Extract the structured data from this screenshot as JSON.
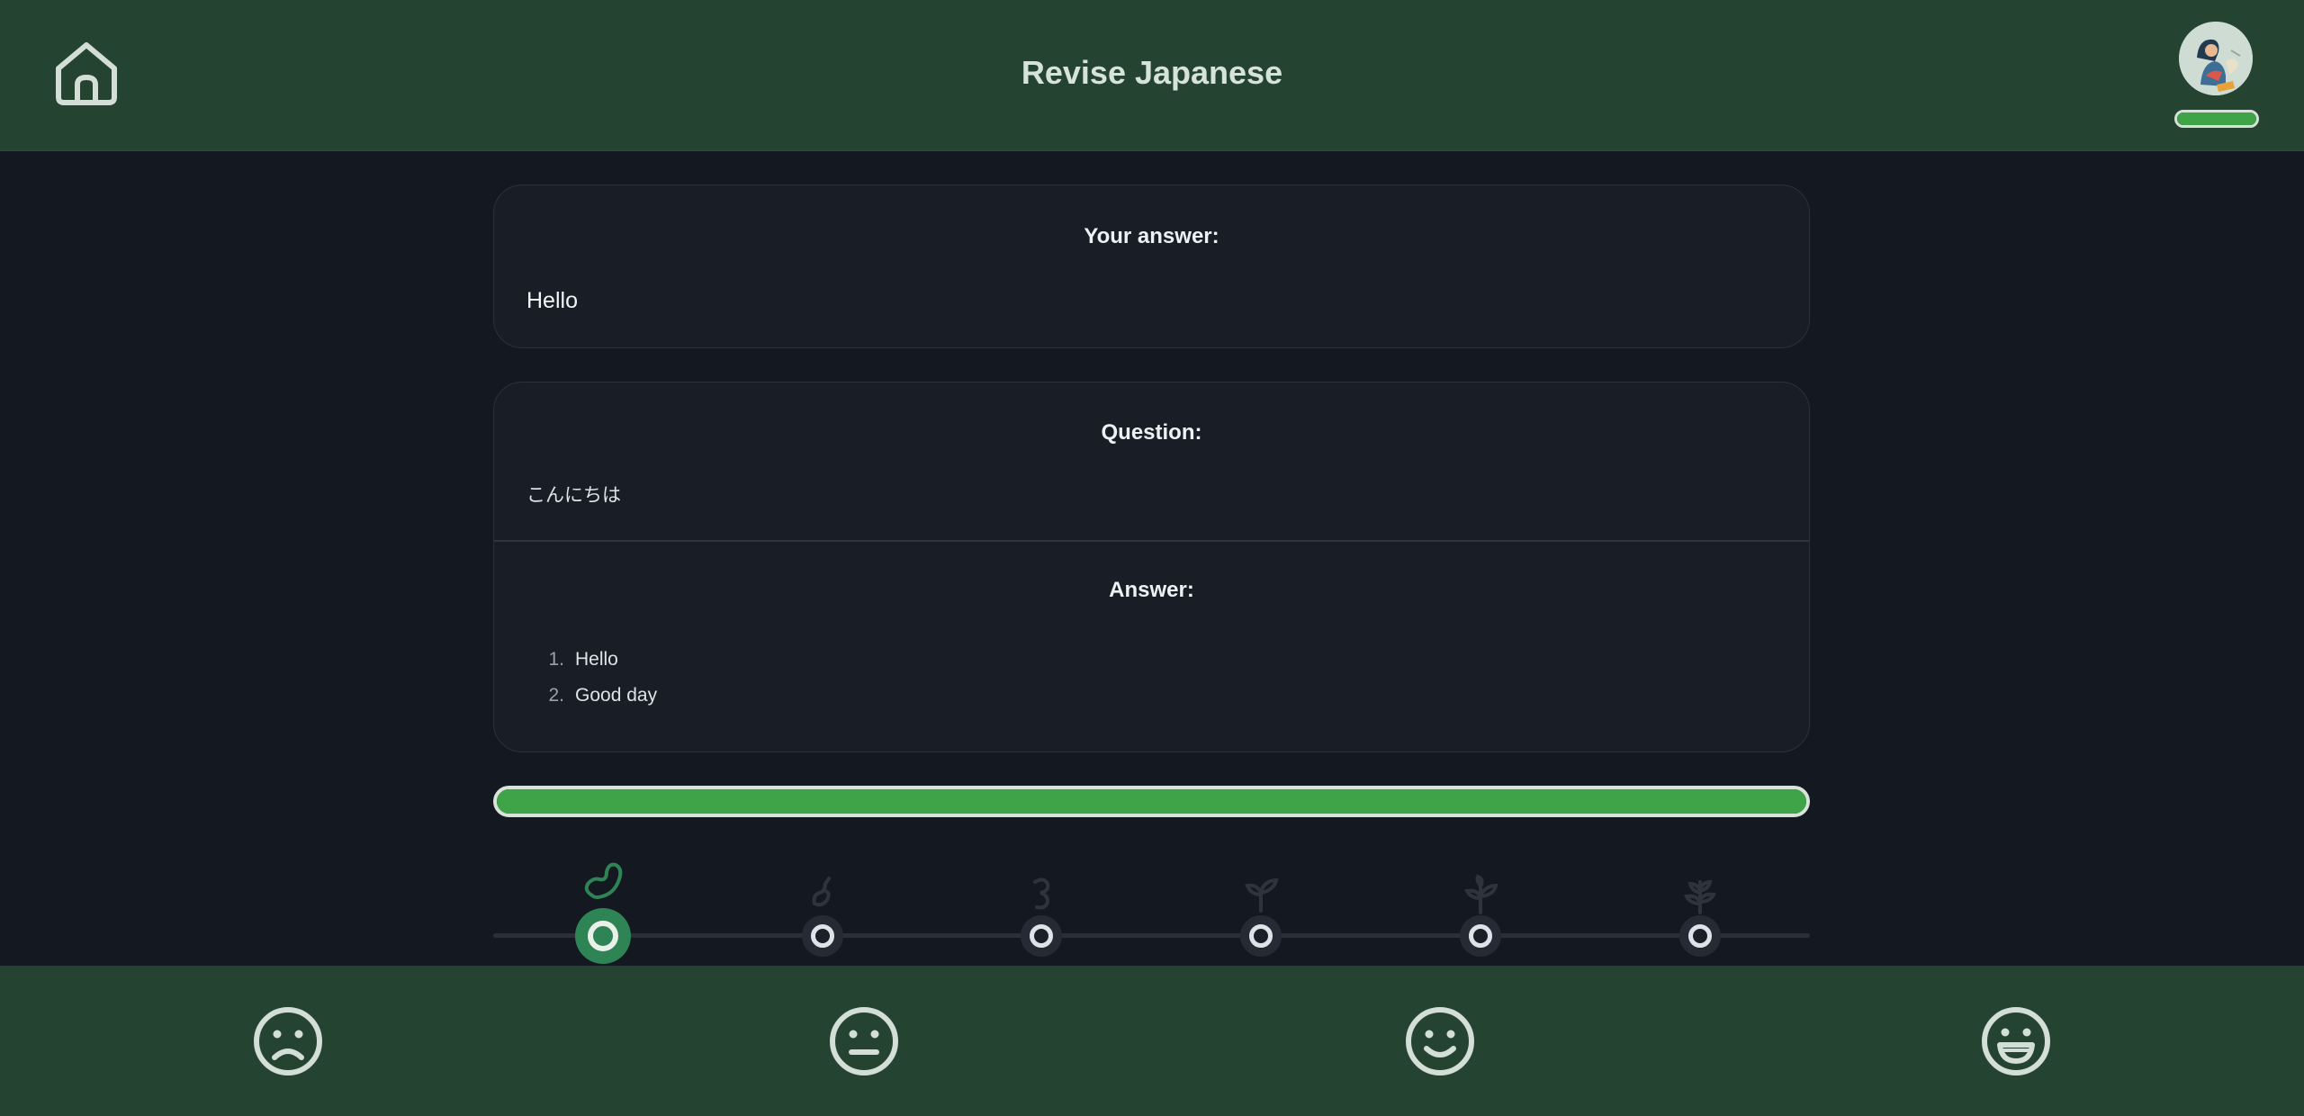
{
  "header": {
    "title": "Revise Japanese",
    "home_icon": "home-icon",
    "avatar_icon": "avatar-image",
    "xp_progress": 1.0
  },
  "answer_card": {
    "heading": "Your answer:",
    "value": "Hello"
  },
  "qa_card": {
    "question_heading": "Question:",
    "question_text": "こんにちは",
    "answer_heading": "Answer:",
    "answers": [
      {
        "num": "1.",
        "text": "Hello"
      },
      {
        "num": "2.",
        "text": "Good day"
      }
    ]
  },
  "progress": {
    "value": 1.0
  },
  "stages": {
    "current_index": 0,
    "items": [
      {
        "icon": "bean-icon"
      },
      {
        "icon": "sprout-seed-icon"
      },
      {
        "icon": "sprout-curl-icon"
      },
      {
        "icon": "seedling-icon"
      },
      {
        "icon": "young-plant-icon"
      },
      {
        "icon": "plant-icon"
      }
    ]
  },
  "rating": [
    {
      "icon": "sad-face-icon"
    },
    {
      "icon": "neutral-face-icon"
    },
    {
      "icon": "smile-face-icon"
    },
    {
      "icon": "grin-face-icon"
    }
  ],
  "colors": {
    "header_bg": "#244431",
    "page_bg": "#141820",
    "card_bg": "#191d26",
    "accent_green": "#3fa447",
    "active_stage": "#2f8456"
  }
}
